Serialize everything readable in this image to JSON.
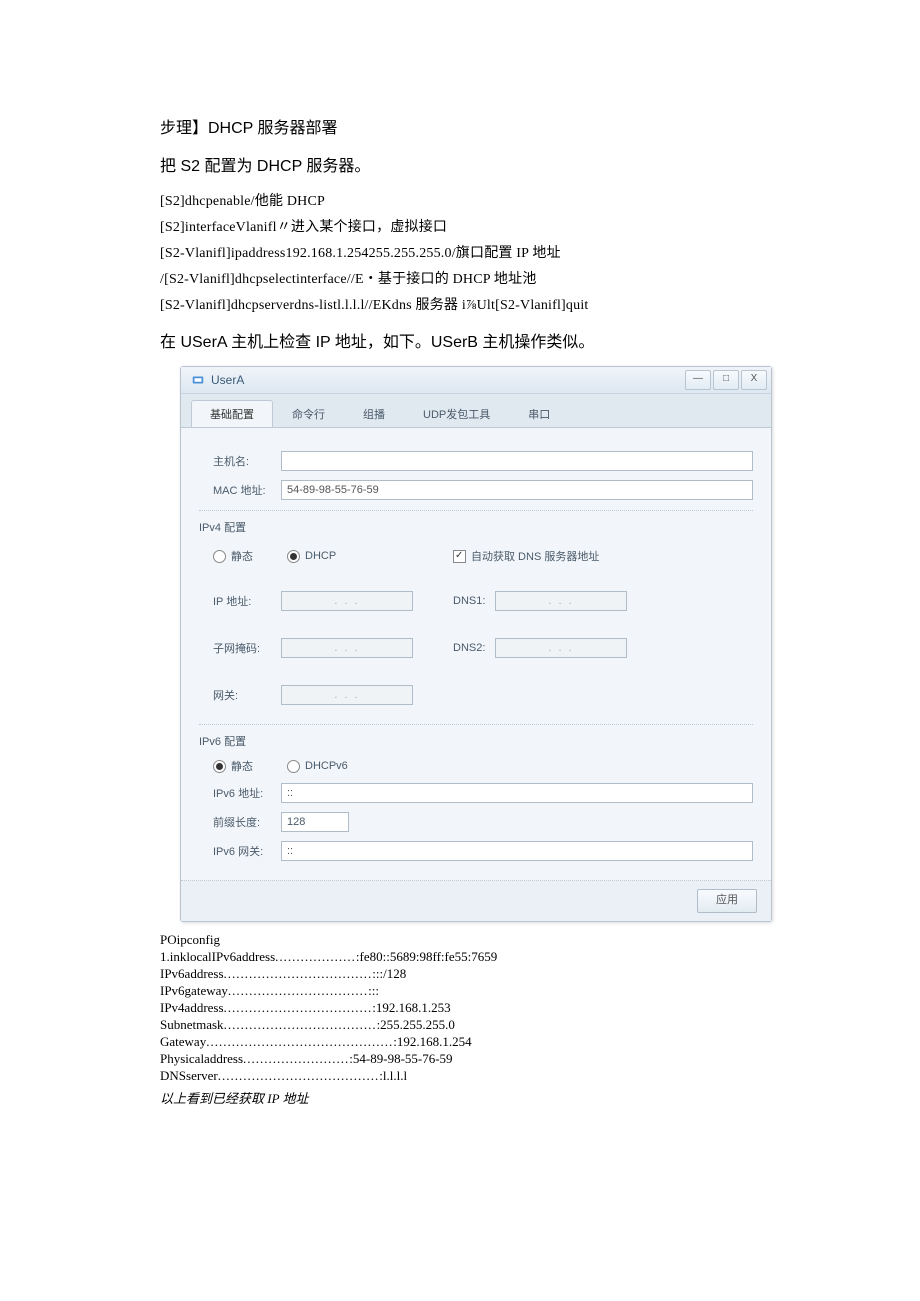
{
  "heading1": "步理】DHCP 服务器部署",
  "heading2": "把 S2 配置为 DHCP 服务器。",
  "code": {
    "l1": "[S2]dhcpenable/他能 DHCP",
    "l2": "[S2]interfaceVlanifl〃进入某个接口，虚拟接口",
    "l3": "[S2-Vlanifl]ipaddress192.168.1.254255.255.255.0/旗口配置 IP 地址",
    "l4": "/[S2-Vlanifl]dhcpselectinterface//E・基于接口的 DHCP 地址池",
    "l5": "[S2-Vlanifl]dhcpserverdns-listl.l.l.l//EKdns 服务器 i⅞Ult[S2-Vlanifl]quit"
  },
  "heading3": "在 USerA 主机上检查 IP 地址，如下。USerB 主机操作类似。",
  "window": {
    "title": "UserA",
    "min": "—",
    "max": "□",
    "close": "X",
    "tabs": {
      "t1": "基础配置",
      "t2": "命令行",
      "t3": "组播",
      "t4": "UDP发包工具",
      "t5": "串口"
    },
    "labels": {
      "host": "主机名:",
      "mac": "MAC 地址:",
      "macval": "54-89-98-55-76-59",
      "ipv4": "IPv4 配置",
      "static": "静态",
      "dhcp": "DHCP",
      "autodns": "自动获取 DNS 服务器地址",
      "ip": "IP 地址:",
      "mask": "子网掩码:",
      "gw": "网关:",
      "dns1": "DNS1:",
      "dns2": "DNS2:",
      "dots": ".   .   .",
      "ipv6": "IPv6 配置",
      "static6": "静态",
      "dhcpv6": "DHCPv6",
      "ipv6addr": "IPv6 地址:",
      "ipv6val": "::",
      "prefix": "前缀长度:",
      "prefixval": "128",
      "ipv6gw": "IPv6 网关:",
      "ipv6gwval": "::",
      "apply": "应用"
    }
  },
  "ipconfig": {
    "hdr": "POipconfig",
    "rows": [
      {
        "k": "1.inklocalIPv6address",
        "v": ":fe80::5689:98ff:fe55:7659",
        "d": "..................."
      },
      {
        "k": "IPv6address",
        "v": ":::/128",
        "d": "..................................."
      },
      {
        "k": "IPv6gateway",
        "v": ":::",
        "d": "................................."
      },
      {
        "k": "IPv4address",
        "v": ":192.168.1.253",
        "d": "..................................."
      },
      {
        "k": "Subnetmask",
        "v": ":255.255.255.0",
        "d": "...................................."
      },
      {
        "k": "Gateway",
        "v": ":192.168.1.254",
        "d": "............................................"
      },
      {
        "k": "Physicaladdress",
        "v": ":54-89-98-55-76-59",
        "d": "........................."
      },
      {
        "k": "DNSserver",
        "v": ":l.l.l.l",
        "d": "......................................"
      }
    ],
    "note": "以上看到已经获取 IP 地址"
  }
}
